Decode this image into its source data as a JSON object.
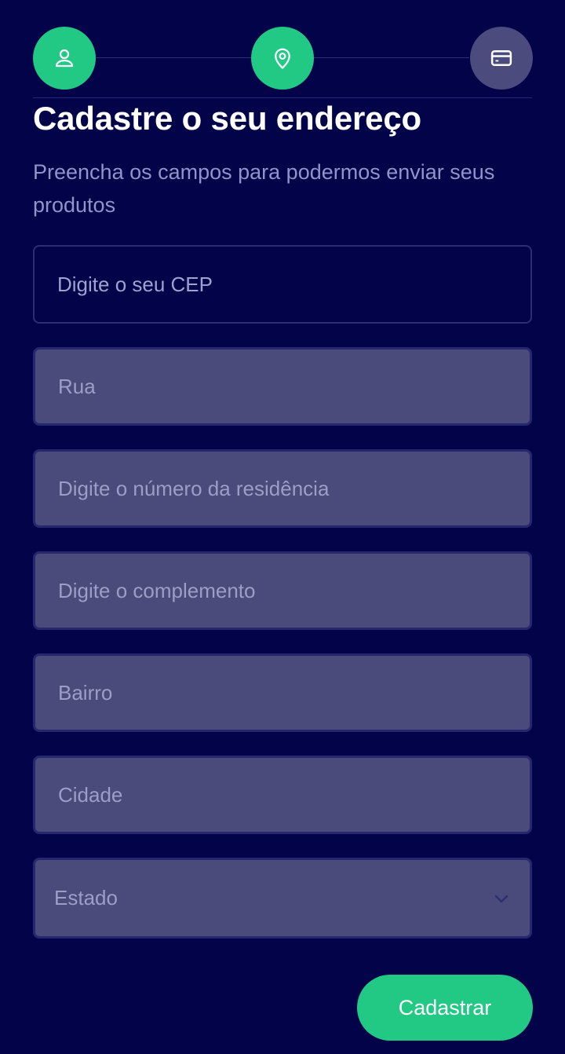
{
  "stepper": {
    "steps": [
      {
        "icon": "user-icon",
        "state": "complete"
      },
      {
        "icon": "map-pin-icon",
        "state": "complete"
      },
      {
        "icon": "credit-card-icon",
        "state": "pending"
      }
    ],
    "colors": {
      "complete": "#22c985",
      "pending": "#4b4b7d"
    }
  },
  "header": {
    "title": "Cadastre o seu endereço",
    "subtitle": "Preencha os campos para podermos enviar seus produtos"
  },
  "form": {
    "cep_placeholder": "Digite o seu CEP",
    "rua_placeholder": "Rua",
    "numero_placeholder": "Digite o número da residência",
    "complemento_placeholder": "Digite o complemento",
    "bairro_placeholder": "Bairro",
    "cidade_placeholder": "Cidade",
    "estado_selected": "Estado",
    "submit_label": "Cadastrar"
  },
  "theme": {
    "background": "#03034a",
    "accent": "#22c985",
    "field_fill": "#4a4a7b"
  }
}
